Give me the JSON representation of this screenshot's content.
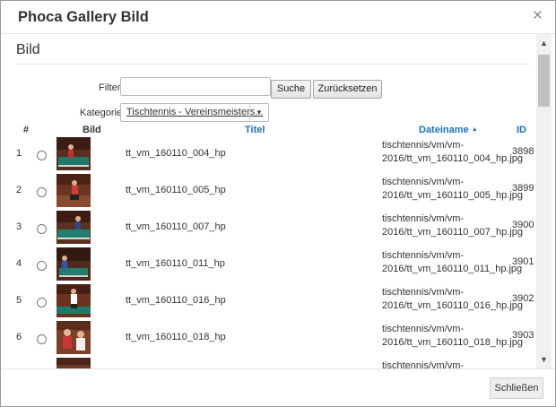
{
  "modal": {
    "title": "Phoca Gallery Bild",
    "close_glyph": "×"
  },
  "section": {
    "title": "Bild"
  },
  "filters": {
    "filter_label": "Filter",
    "filter_value": "",
    "search_button": "Suche",
    "reset_button": "Zurücksetzen",
    "category_label": "Kategorie",
    "category_value": "Tischtennis - Vereinsmeisters..."
  },
  "table": {
    "headers": {
      "num": "#",
      "image": "Bild",
      "title": "Titel",
      "filename": "Dateiname",
      "sort_indicator": "▲",
      "id": "ID"
    },
    "rows": [
      {
        "num": "1",
        "title": "tt_vm_160110_004_hp",
        "file_line1": "tischtennis/vm/vm-",
        "file_line2": "2016/tt_vm_160110_004_hp.jpg",
        "id": "3898"
      },
      {
        "num": "2",
        "title": "tt_vm_160110_005_hp",
        "file_line1": "tischtennis/vm/vm-",
        "file_line2": "2016/tt_vm_160110_005_hp.jpg",
        "id": "3899"
      },
      {
        "num": "3",
        "title": "tt_vm_160110_007_hp",
        "file_line1": "tischtennis/vm/vm-",
        "file_line2": "2016/tt_vm_160110_007_hp.jpg",
        "id": "3900"
      },
      {
        "num": "4",
        "title": "tt_vm_160110_011_hp",
        "file_line1": "tischtennis/vm/vm-",
        "file_line2": "2016/tt_vm_160110_011_hp.jpg",
        "id": "3901"
      },
      {
        "num": "5",
        "title": "tt_vm_160110_016_hp",
        "file_line1": "tischtennis/vm/vm-",
        "file_line2": "2016/tt_vm_160110_016_hp.jpg",
        "id": "3902"
      },
      {
        "num": "6",
        "title": "tt_vm_160110_018_hp",
        "file_line1": "tischtennis/vm/vm-",
        "file_line2": "2016/tt_vm_160110_018_hp.jpg",
        "id": "3903"
      },
      {
        "num": "",
        "title": "",
        "file_line1": "tischtennis/vm/vm-",
        "file_line2": "",
        "id": ""
      }
    ]
  },
  "scrollbar": {
    "up_glyph": "▲",
    "down_glyph": "▼"
  },
  "footer": {
    "close_button": "Schließen"
  },
  "colors": {
    "link": "#1e70b9",
    "border": "#e5e5e5"
  }
}
